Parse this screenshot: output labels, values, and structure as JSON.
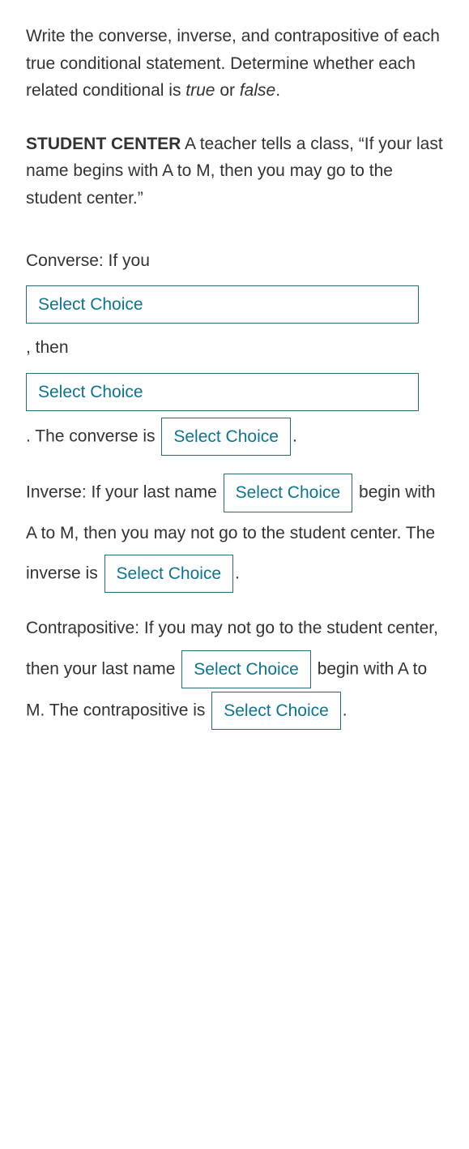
{
  "instructions": {
    "main": "Write the converse, inverse, and contrapositive of each true conditional statement. Determine whether each related conditional is ",
    "true_word": "true",
    "or_word": " or ",
    "false_word": "false",
    "period": "."
  },
  "context": {
    "heading": "STUDENT CENTER",
    "body": "  A teacher tells a class, “If your last name begins with A to M, then you may go to the student center.”"
  },
  "converse": {
    "lead": "Converse: If you",
    "then_text": ", then",
    "after_wide2": ". The converse is ",
    "trailing_period": "."
  },
  "inverse": {
    "lead": "Inverse: If your last name ",
    "after_select1": " begin with A to M, then you may not go to the student center. The inverse is ",
    "trailing_period": "."
  },
  "contrapositive": {
    "lead": "Contrapositive: If you may not go to the student center, then your last name ",
    "after_select1": " begin with A to M. The contrapositive is ",
    "trailing_period": "."
  },
  "select_placeholder": "Select Choice"
}
